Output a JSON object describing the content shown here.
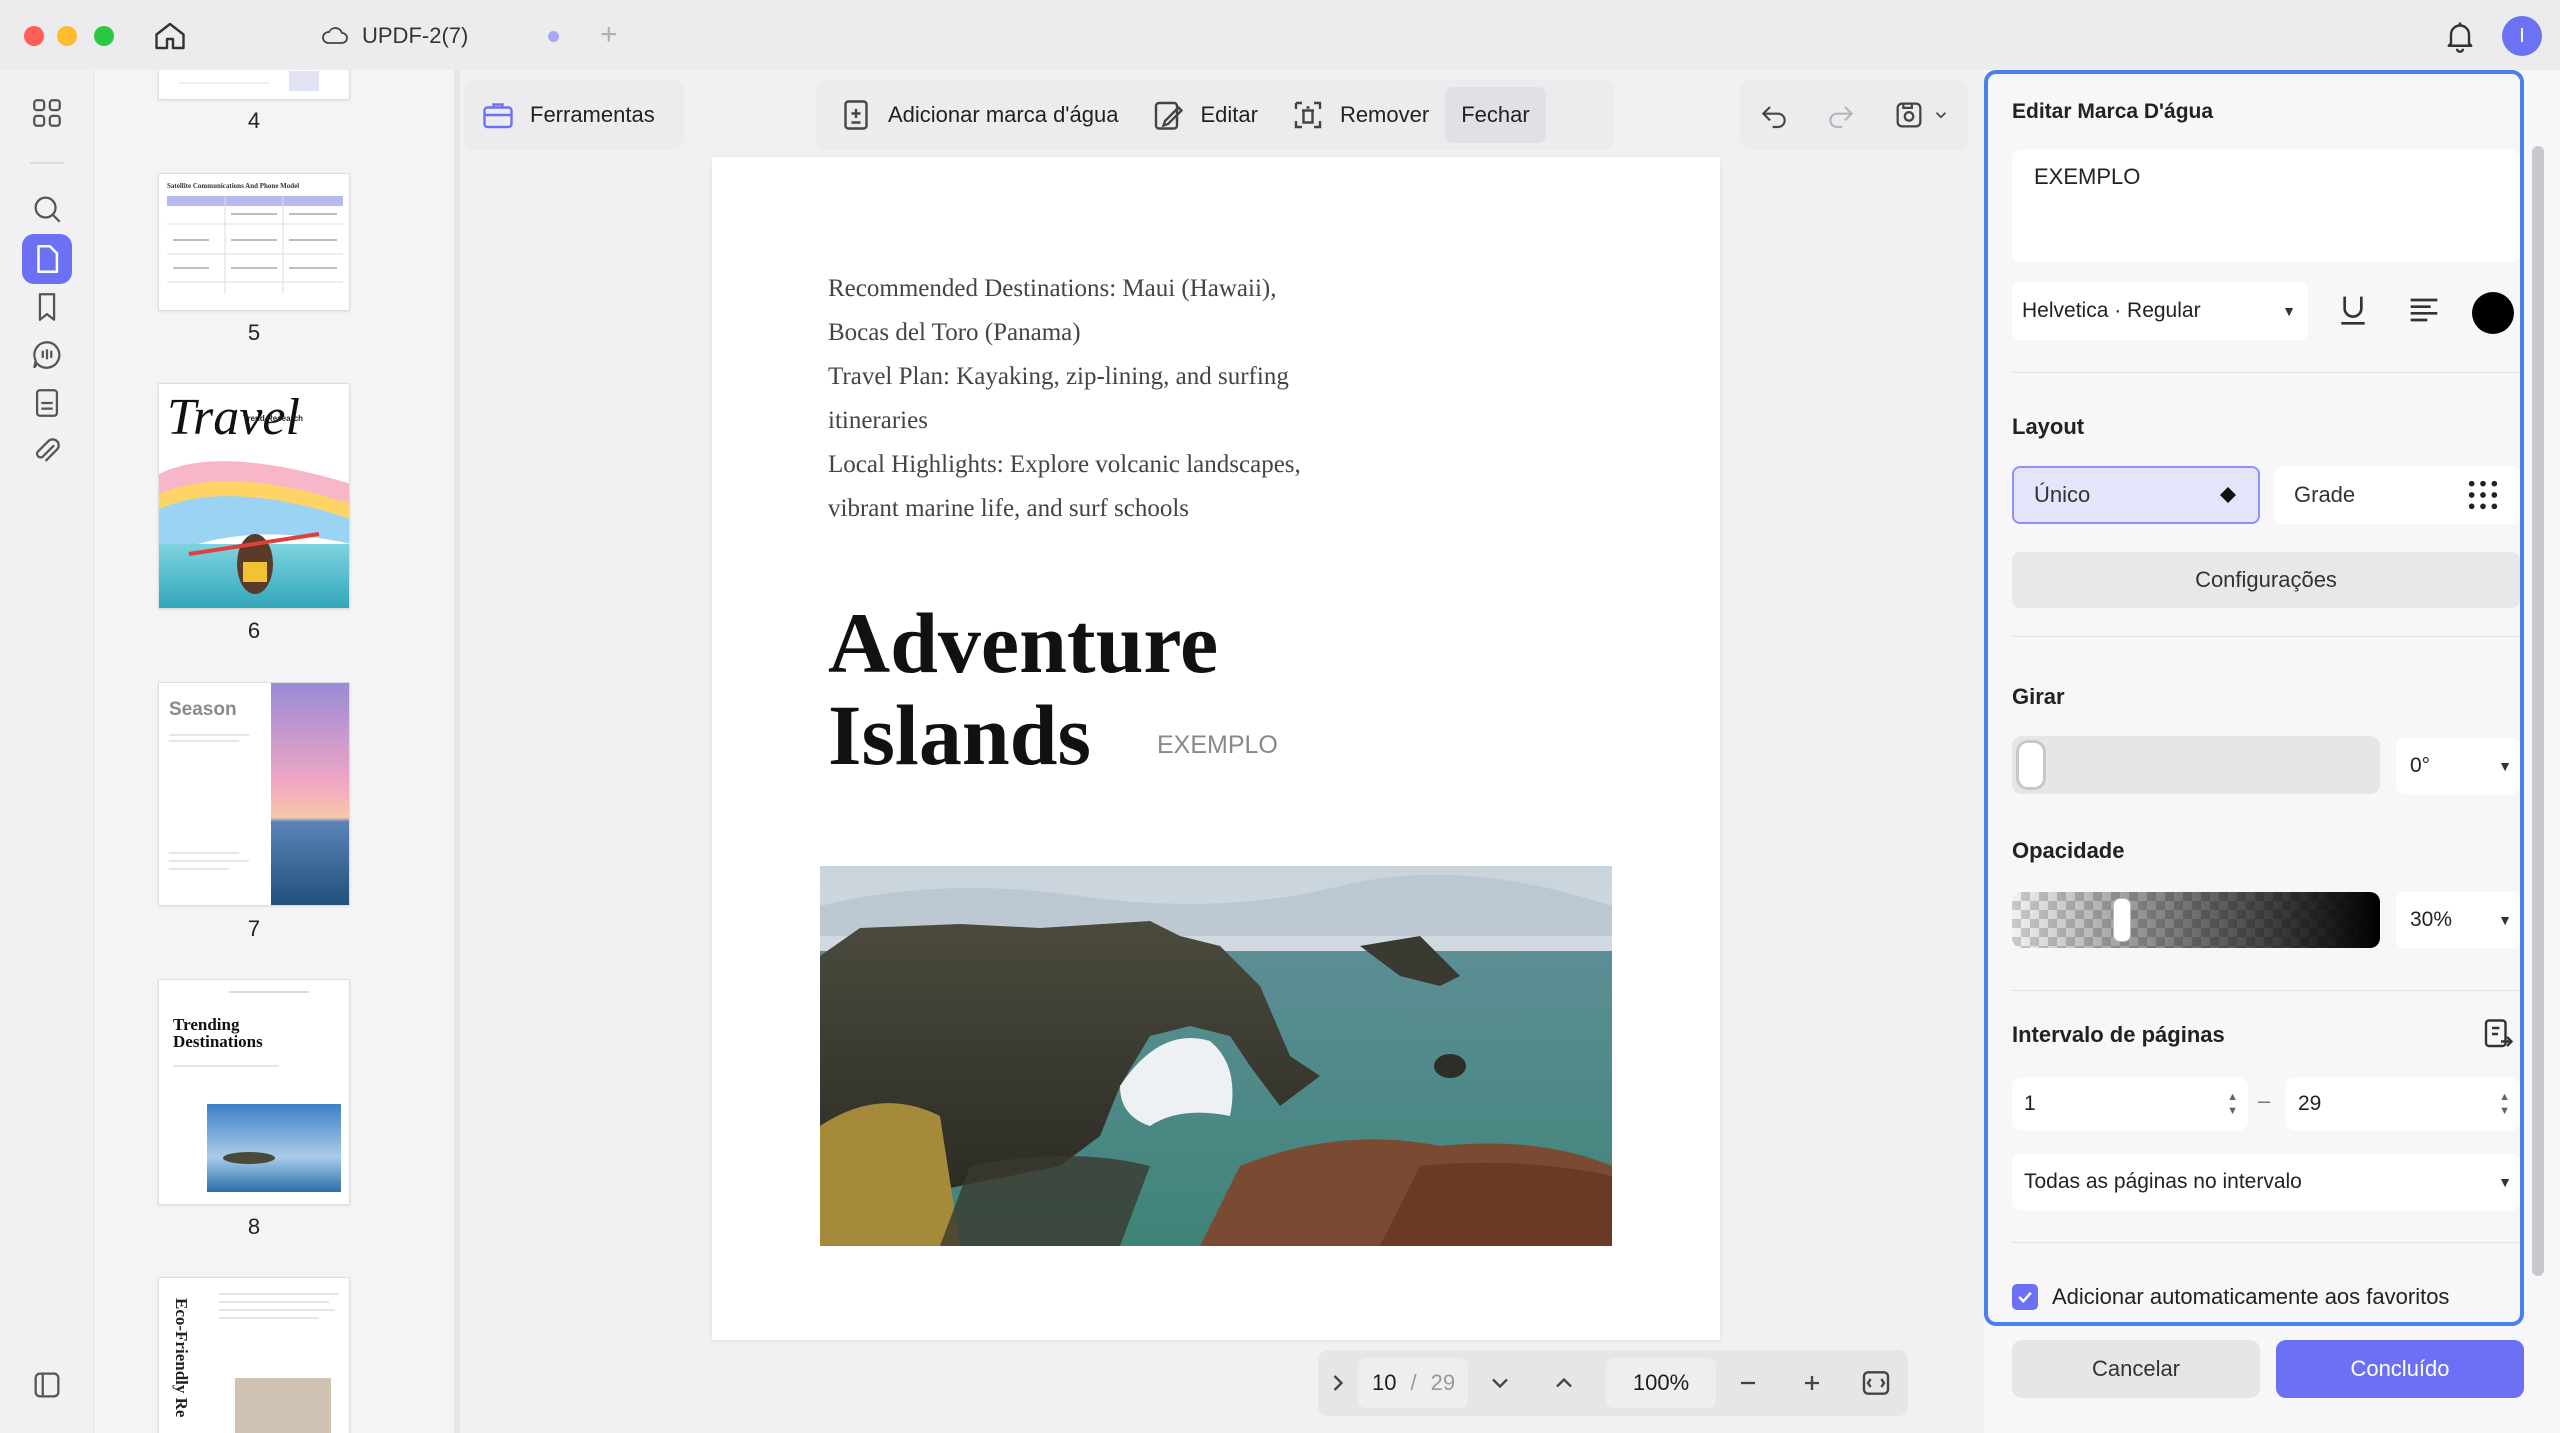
{
  "window": {
    "tab_title": "UPDF-2(7)",
    "new_tab": "+",
    "avatar_initial": "I"
  },
  "thumbnails": [
    {
      "page": "4"
    },
    {
      "page": "5",
      "title": "Satellite Communications And Phone Model"
    },
    {
      "page": "6",
      "title": "Travel",
      "subtitle": "Trend Research"
    },
    {
      "page": "7",
      "title": "Season"
    },
    {
      "page": "8",
      "title": "Trending Destinations"
    },
    {
      "page": "",
      "title": "Eco-Friendly Re"
    }
  ],
  "toolbar": {
    "tools_label": "Ferramentas",
    "add_watermark_label": "Adicionar marca d'água",
    "edit_label": "Editar",
    "remove_label": "Remover",
    "close_label": "Fechar"
  },
  "document": {
    "lines": [
      "Recommended Destinations: Maui (Hawaii),",
      "Bocas del Toro (Panama)",
      "Travel Plan: Kayaking, zip-lining, and surfing",
      "itineraries",
      "Local Highlights: Explore volcanic landscapes,",
      "vibrant marine life, and surf schools"
    ],
    "title_line1": "Adventure",
    "title_line2": "Islands",
    "watermark_text": "EXEMPLO"
  },
  "pager": {
    "current_page": "10",
    "separator": "/",
    "total_pages": "29",
    "zoom": "100%"
  },
  "panel": {
    "title": "Editar Marca D'água",
    "watermark_text": "EXEMPLO",
    "font": "Helvetica · Regular",
    "text_color": "#000000",
    "layout_label": "Layout",
    "layout_single": "Único",
    "layout_grid": "Grade",
    "settings_label": "Configurações",
    "rotate_label": "Girar",
    "rotate_value": "0°",
    "opacity_label": "Opacidade",
    "opacity_value": "30%",
    "page_range_label": "Intervalo de páginas",
    "range_from": "1",
    "range_dash": "–",
    "range_to": "29",
    "range_option": "Todas as páginas no intervalo",
    "auto_favorite_label": "Adicionar automaticamente aos favoritos",
    "auto_favorite_checked": true,
    "cancel_label": "Cancelar",
    "done_label": "Concluído"
  },
  "colors": {
    "accent": "#6c70f5",
    "panel_border": "#4a80ee"
  }
}
